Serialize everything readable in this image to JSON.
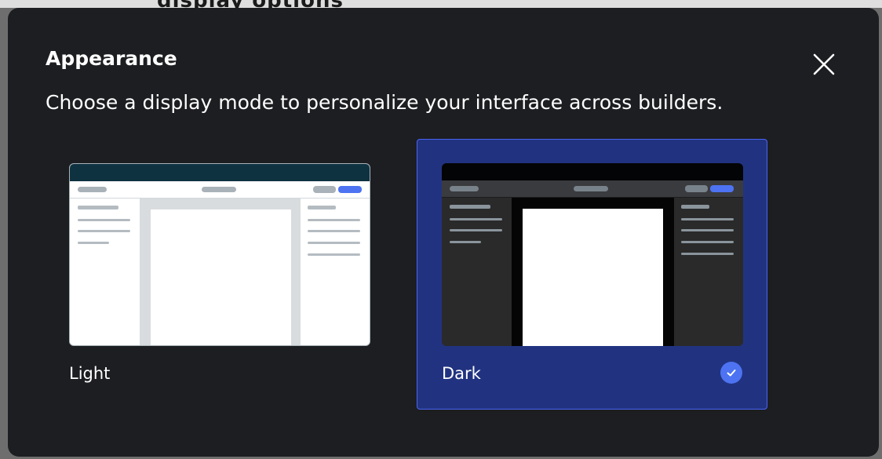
{
  "backdrop": {
    "heading_fragment": "display options"
  },
  "modal": {
    "title": "Appearance",
    "subtitle": "Choose a display mode to personalize your interface across builders.",
    "close_icon": "close-icon"
  },
  "options": [
    {
      "label": "Light",
      "selected": false,
      "preview": "light-mode-preview"
    },
    {
      "label": "Dark",
      "selected": true,
      "preview": "dark-mode-preview",
      "selected_icon": "check-circle-icon"
    }
  ],
  "colors": {
    "modal_bg": "#1c1e21",
    "selected_bg": "#213380",
    "selected_border": "#4a64f5",
    "accent": "#4d73f2"
  }
}
